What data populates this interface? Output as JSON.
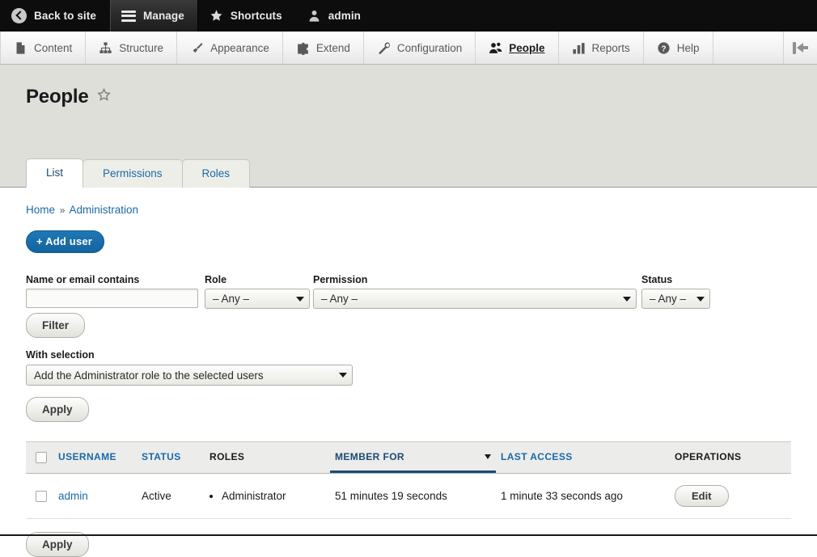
{
  "toolbar": {
    "items": [
      {
        "label": "Back to site",
        "icon": "back-circle-icon",
        "active": false
      },
      {
        "label": "Manage",
        "icon": "hamburger-icon",
        "active": true
      },
      {
        "label": "Shortcuts",
        "icon": "star-icon",
        "active": false
      },
      {
        "label": "admin",
        "icon": "user-icon",
        "active": false
      }
    ]
  },
  "menu": {
    "items": [
      {
        "label": "Content",
        "icon": "file-icon",
        "active": false
      },
      {
        "label": "Structure",
        "icon": "sitemap-icon",
        "active": false
      },
      {
        "label": "Appearance",
        "icon": "paintbrush-icon",
        "active": false
      },
      {
        "label": "Extend",
        "icon": "puzzle-piece-icon",
        "active": false
      },
      {
        "label": "Configuration",
        "icon": "wrench-icon",
        "active": false
      },
      {
        "label": "People",
        "icon": "people-icon",
        "active": true
      },
      {
        "label": "Reports",
        "icon": "bar-chart-icon",
        "active": false
      },
      {
        "label": "Help",
        "icon": "question-mark-icon",
        "active": false
      }
    ],
    "collapse_icon": "collapse-toolbar-icon"
  },
  "page": {
    "title": "People",
    "favorite_icon": "star-outline-icon",
    "tabs": [
      {
        "label": "List",
        "active": true
      },
      {
        "label": "Permissions",
        "active": false
      },
      {
        "label": "Roles",
        "active": false
      }
    ]
  },
  "breadcrumb": {
    "items": [
      "Home",
      "Administration"
    ],
    "separator": "»"
  },
  "actions": {
    "add_user_label": "+ Add user"
  },
  "filters": {
    "name_label": "Name or email contains",
    "name_value": "",
    "name_placeholder": "",
    "role_label": "Role",
    "role_value": "– Any –",
    "permission_label": "Permission",
    "permission_value": "– Any –",
    "status_label": "Status",
    "status_value": "– Any –",
    "filter_button": "Filter"
  },
  "bulk": {
    "label": "With selection",
    "action_value": "Add the Administrator role to the selected users",
    "apply_button": "Apply"
  },
  "table": {
    "columns": [
      {
        "key": "checkbox",
        "label": "",
        "sortable": false,
        "sorted": false
      },
      {
        "key": "username",
        "label": "USERNAME",
        "sortable": true,
        "sorted": false
      },
      {
        "key": "status",
        "label": "STATUS",
        "sortable": true,
        "sorted": false
      },
      {
        "key": "roles",
        "label": "ROLES",
        "sortable": false,
        "sorted": false
      },
      {
        "key": "member_for",
        "label": "MEMBER FOR",
        "sortable": true,
        "sorted": true,
        "sort_dir": "desc"
      },
      {
        "key": "last_access",
        "label": "LAST ACCESS",
        "sortable": true,
        "sorted": false
      },
      {
        "key": "operations",
        "label": "OPERATIONS",
        "sortable": false,
        "sorted": false
      }
    ],
    "rows": [
      {
        "selected": false,
        "username": "admin",
        "status": "Active",
        "roles": [
          "Administrator"
        ],
        "member_for": "51 minutes 19 seconds",
        "last_access": "1 minute 33 seconds ago",
        "operation_label": "Edit"
      }
    ]
  },
  "footer": {
    "apply_button": "Apply"
  },
  "colors": {
    "toolbar_bg": "#0d0d0d",
    "header_bg": "#dedfd9",
    "link": "#1a6aa8",
    "accent": "#1a4b73",
    "primary_button": "#14649e"
  }
}
